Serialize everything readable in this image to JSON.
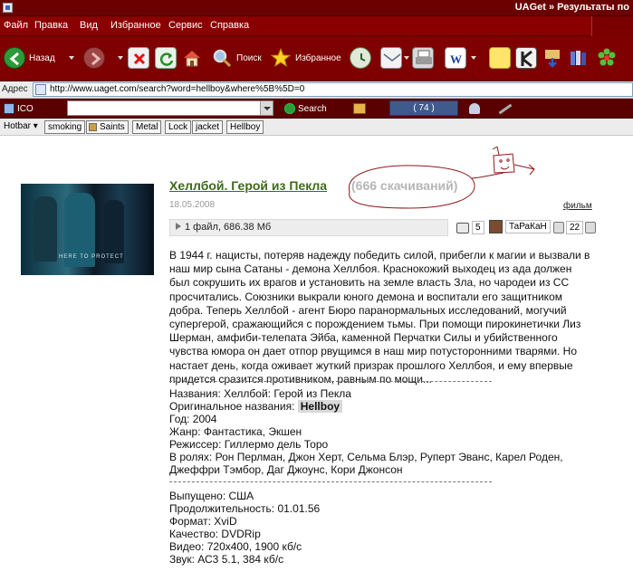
{
  "window": {
    "title": "UAGet » Результаты по"
  },
  "menu": [
    "Файл",
    "Правка",
    "Вид",
    "Избранное",
    "Сервис",
    "Справка"
  ],
  "toolbar": {
    "back": "Назад",
    "search": "Поиск",
    "favorites": "Избранное"
  },
  "address": {
    "label": "Адрес",
    "url": "http://www.uaget.com/search?word=hellboy&where%5B%5D=0"
  },
  "searchbar": {
    "ico": "ICO",
    "search": "Search",
    "counter": "( 74 )"
  },
  "hotbar": {
    "label": "Hotbar",
    "items": [
      "smoking",
      "Saints",
      "Metal",
      "Lock",
      "jacket",
      "Hellboy"
    ]
  },
  "result": {
    "title": "Хеллбой. Герой из Пекла",
    "downloads": "(666 скачиваний)",
    "date": "18.05.2008",
    "category": "фильм",
    "file_info": "1 файл, 686.38 Мб",
    "comments_count": "5",
    "author": "ТаРаКаН",
    "rating": "22",
    "poster_tagline": "HERE TO PROTECT",
    "description": "В 1944 г. нацисты, потеряв надежду победить силой, прибегли к магии и вызвали в наш мир сына Сатаны - демона Хеллбоя. Краснокожий выходец из ада должен был сокрушить их врагов и установить на земле власть Зла, но чародеи из СС просчитались. Союзники выкрали юного демона и воспитали его защитником добра. Теперь Хеллбой - агент Бюро паранормальных исследований, могучий супергерой, сражающийся с порождением тьмы. При помощи пирокинетички Лиз Шерман, амфиби-телепата Эйба, каменной Перчатки Силы и убийственного чувства юмора он дает отпор рвущимся в наш мир потусторонними тварями. Но настает день, когда оживает жуткий призрак прошлого Хеллбоя, и ему впервые придется сразится противником, равным по мощи...",
    "names": "Названия: Хеллбой: Герой из Пекла",
    "original_label": "Оригинальное названия:",
    "original_value": "Hellboy",
    "year": "Год: 2004",
    "genre": "Жанр: Фантастика, Экшен",
    "director": "Режиссер: Гиллермо дель Торо",
    "cast_1": "В ролях: Рон Перлман, Джон Херт, Сельма Блэр, Руперт Эванс, Карел Роден,",
    "cast_2": "Джеффри Тэмбор, Даг Джоунс, Кори Джонсон",
    "released": "Выпущено: США",
    "duration": "Продолжительность: 01.01.56",
    "format": "Формат: XviD",
    "quality": "Качество: DVDRip",
    "video": "Видео: 720x400, 1900 кб/с",
    "audio": "Звук: АС3 5.1, 384 кб/с"
  },
  "colors": {
    "chrome_dark_red": "#7e0000",
    "title_green": "#3d6b1f",
    "annotation_red": "#8b1a1a"
  }
}
